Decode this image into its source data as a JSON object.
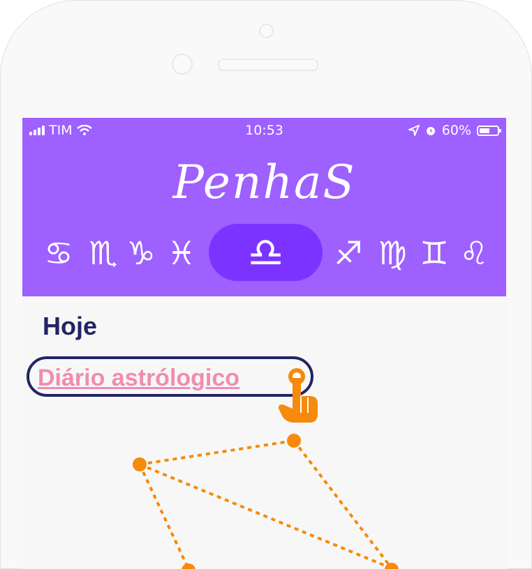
{
  "status_bar": {
    "carrier": "TIM",
    "time": "10:53",
    "battery": "60%",
    "battery_level": 0.6
  },
  "app": {
    "logo_text": "PenhaS",
    "brand_color": "#9e60ff",
    "active_sign_color": "#7d33ff"
  },
  "zodiac": {
    "signs": [
      {
        "name": "cancer",
        "glyph": "♋"
      },
      {
        "name": "scorpio",
        "glyph": "♏"
      },
      {
        "name": "capricorn",
        "glyph": "♑"
      },
      {
        "name": "pisces",
        "glyph": "♓"
      },
      {
        "name": "libra",
        "glyph": "♎",
        "active": true
      },
      {
        "name": "sagittarius",
        "glyph": "♐"
      },
      {
        "name": "virgo",
        "glyph": "♍"
      },
      {
        "name": "gemini",
        "glyph": "♊"
      },
      {
        "name": "leo",
        "glyph": "♌"
      }
    ]
  },
  "main": {
    "section_title": "Hoje",
    "link_label": "Diário astrólogico",
    "link_color": "#f08cb0",
    "highlight_icon": "tap-hand-icon",
    "constellation_icon": "libra-constellation-icon",
    "accent_color": "#f58a0b"
  }
}
